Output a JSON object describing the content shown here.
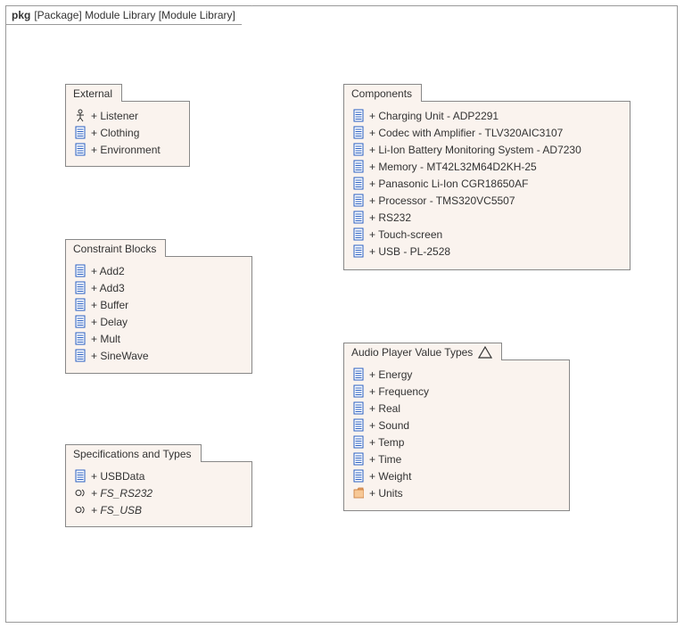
{
  "frame": {
    "kind_kw": "pkg",
    "kind": "[Package]",
    "name": "Module Library",
    "bracket": "[Module Library]"
  },
  "packages": {
    "external": {
      "title": "External",
      "items": [
        {
          "icon": "actor",
          "label": "+ Listener"
        },
        {
          "icon": "block",
          "label": "+ Clothing"
        },
        {
          "icon": "block",
          "label": "+ Environment"
        }
      ]
    },
    "constraints": {
      "title": "Constraint Blocks",
      "items": [
        {
          "icon": "block",
          "label": "+ Add2"
        },
        {
          "icon": "block",
          "label": "+ Add3"
        },
        {
          "icon": "block",
          "label": "+ Buffer"
        },
        {
          "icon": "block",
          "label": "+ Delay"
        },
        {
          "icon": "block",
          "label": "+ Mult"
        },
        {
          "icon": "block",
          "label": "+ SineWave"
        }
      ]
    },
    "specs": {
      "title": "Specifications and Types",
      "items": [
        {
          "icon": "block",
          "label": "+ USBData"
        },
        {
          "icon": "interface",
          "label": "+ FS_RS232",
          "italic": true
        },
        {
          "icon": "interface",
          "label": "+ FS_USB",
          "italic": true
        }
      ]
    },
    "components": {
      "title": "Components",
      "items": [
        {
          "icon": "block",
          "label": "+ Charging Unit - ADP2291"
        },
        {
          "icon": "block",
          "label": "+ Codec with Amplifier - TLV320AIC3107"
        },
        {
          "icon": "block",
          "label": "+ Li-Ion Battery Monitoring System - AD7230"
        },
        {
          "icon": "block",
          "label": "+ Memory - MT42L32M64D2KH-25"
        },
        {
          "icon": "block",
          "label": "+ Panasonic Li-Ion CGR18650AF"
        },
        {
          "icon": "block",
          "label": "+ Processor - TMS320VC5507"
        },
        {
          "icon": "block",
          "label": "+ RS232"
        },
        {
          "icon": "block",
          "label": "+ Touch-screen"
        },
        {
          "icon": "block",
          "label": "+ USB - PL-2528"
        }
      ]
    },
    "valuetypes": {
      "title": "Audio Player Value Types",
      "has_triangle": true,
      "items": [
        {
          "icon": "block",
          "label": "+ Energy"
        },
        {
          "icon": "block",
          "label": "+ Frequency"
        },
        {
          "icon": "block",
          "label": "+ Real"
        },
        {
          "icon": "block",
          "label": "+ Sound"
        },
        {
          "icon": "block",
          "label": "+ Temp"
        },
        {
          "icon": "block",
          "label": "+ Time"
        },
        {
          "icon": "block",
          "label": "+ Weight"
        },
        {
          "icon": "folder",
          "label": "+ Units"
        }
      ]
    }
  }
}
